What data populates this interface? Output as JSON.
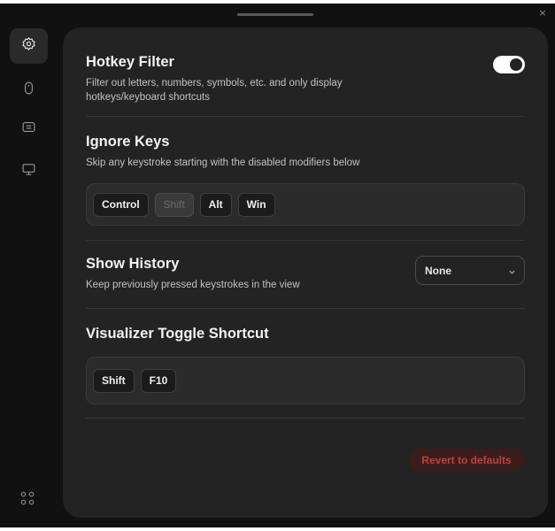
{
  "window": {
    "close_glyph": "×"
  },
  "sidebar": {
    "items": [
      {
        "name": "settings",
        "icon": "gear-icon",
        "active": true
      },
      {
        "name": "mouse",
        "icon": "mouse-icon",
        "active": false
      },
      {
        "name": "keyboard",
        "icon": "keyboard-icon",
        "active": false
      },
      {
        "name": "display",
        "icon": "monitor-icon",
        "active": false
      }
    ],
    "bottom_icon": "grid-dots-icon"
  },
  "hotkey_filter": {
    "title": "Hotkey Filter",
    "description": "Filter out letters, numbers, symbols, etc. and only display hotkeys/keyboard shortcuts",
    "enabled": true
  },
  "ignore_keys": {
    "title": "Ignore Keys",
    "description": "Skip any keystroke starting with the disabled modifiers below",
    "keys": [
      {
        "label": "Control",
        "disabled": false
      },
      {
        "label": "Shift",
        "disabled": true
      },
      {
        "label": "Alt",
        "disabled": false
      },
      {
        "label": "Win",
        "disabled": false
      }
    ]
  },
  "show_history": {
    "title": "Show History",
    "description": "Keep previously pressed keystrokes in the view",
    "selected": "None"
  },
  "toggle_shortcut": {
    "title": "Visualizer Toggle Shortcut",
    "keys": [
      "Shift",
      "F10"
    ]
  },
  "revert_label": "Revert to defaults",
  "colors": {
    "background": "#111111",
    "panel": "#232323",
    "danger": "#c0403c",
    "danger_bg": "#3a1c1c"
  }
}
